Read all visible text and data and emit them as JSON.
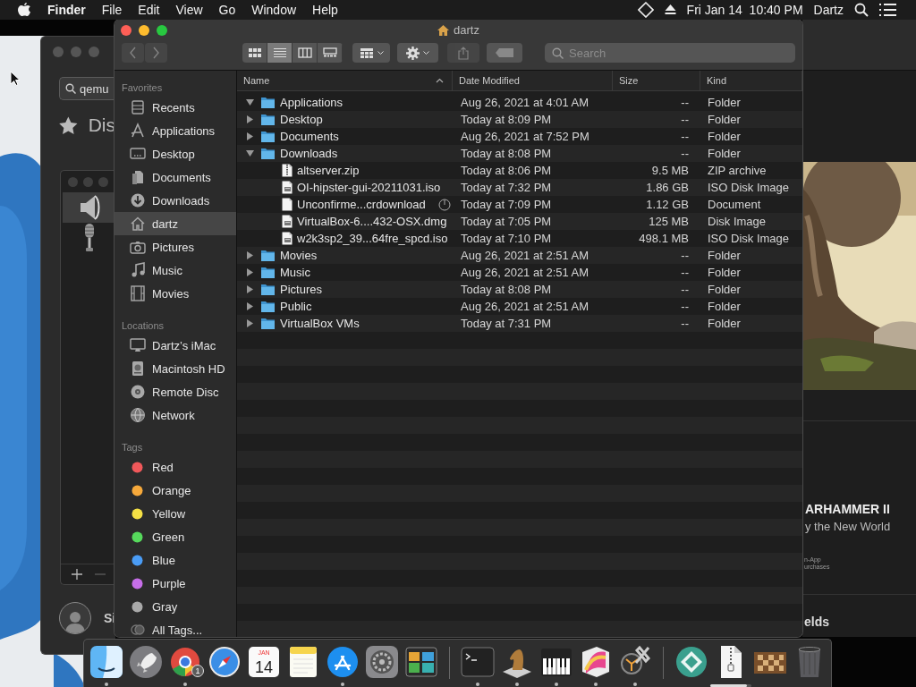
{
  "menu_bar": {
    "app": "Finder",
    "menus": [
      "File",
      "Edit",
      "View",
      "Go",
      "Window",
      "Help"
    ],
    "clock": "Fri Jan 14  10:40 PM",
    "user": "Dartz"
  },
  "preferences_window": {
    "search_value": "qemu",
    "heading": "Dis",
    "user_label": "Si",
    "devices": [
      {
        "kind": "speaker",
        "selected": true
      },
      {
        "kind": "microphone",
        "selected": false
      }
    ]
  },
  "app_store_window": {
    "title": "ARHAMMER II",
    "subtitle": "y the New World",
    "fine_print": [
      "n-App",
      "urchases"
    ],
    "section": "elds"
  },
  "finder": {
    "title": "dartz",
    "nav_buttons": [
      {
        "kind": "back",
        "disabled": true
      },
      {
        "kind": "forward",
        "disabled": true
      }
    ],
    "view_modes": [
      {
        "kind": "icons",
        "selected": false
      },
      {
        "kind": "list",
        "selected": true
      },
      {
        "kind": "columns",
        "selected": false
      },
      {
        "kind": "gallery",
        "selected": false
      }
    ],
    "share_button": {
      "disabled": true
    },
    "search": {
      "placeholder": "Search"
    },
    "sidebar": [
      {
        "heading": "Favorites",
        "items": [
          {
            "label": "Recents",
            "selected": false
          },
          {
            "label": "Applications",
            "selected": false
          },
          {
            "label": "Desktop",
            "selected": false
          },
          {
            "label": "Documents",
            "selected": false
          },
          {
            "label": "Downloads",
            "selected": false
          },
          {
            "label": "dartz",
            "selected": true
          },
          {
            "label": "Pictures",
            "selected": false
          },
          {
            "label": "Music",
            "selected": false
          },
          {
            "label": "Movies",
            "selected": false
          }
        ]
      },
      {
        "heading": "Locations",
        "items": [
          {
            "label": "Dartz’s iMac",
            "selected": false
          },
          {
            "label": "Macintosh HD",
            "selected": false
          },
          {
            "label": "Remote Disc",
            "selected": false
          },
          {
            "label": "Network",
            "selected": false
          }
        ]
      },
      {
        "heading": "Tags",
        "items": [
          {
            "label": "Red",
            "color": "#f0585a",
            "selected": false
          },
          {
            "label": "Orange",
            "color": "#f6a93b",
            "selected": false
          },
          {
            "label": "Yellow",
            "color": "#f5e045",
            "selected": false
          },
          {
            "label": "Green",
            "color": "#56d95c",
            "selected": false
          },
          {
            "label": "Blue",
            "color": "#4a9cf5",
            "selected": false
          },
          {
            "label": "Purple",
            "color": "#c66ee8",
            "selected": false
          },
          {
            "label": "Gray",
            "color": "#a9a9a9",
            "selected": false
          },
          {
            "label": "All Tags...",
            "selected": false
          }
        ]
      }
    ],
    "columns": [
      {
        "label": "Name",
        "sorted": true
      },
      {
        "label": "Date Modified",
        "sorted": false
      },
      {
        "label": "Size",
        "sorted": false
      },
      {
        "label": "Kind",
        "sorted": false
      }
    ],
    "rows": [
      {
        "name": "Applications",
        "date": "Aug 26, 2021 at 4:01 AM",
        "size": "--",
        "file_kind": "Folder",
        "kind": "folder",
        "expanded": true
      },
      {
        "name": "Desktop",
        "date": "Today at 8:09 PM",
        "size": "--",
        "file_kind": "Folder",
        "kind": "folder",
        "expanded": false
      },
      {
        "name": "Documents",
        "date": "Aug 26, 2021 at 7:52 PM",
        "size": "--",
        "file_kind": "Folder",
        "kind": "folder",
        "expanded": false
      },
      {
        "name": "Downloads",
        "date": "Today at 8:08 PM",
        "size": "--",
        "file_kind": "Folder",
        "kind": "folder",
        "expanded": true,
        "children": [
          {
            "name": "altserver.zip",
            "date": "Today at 8:06 PM",
            "size": "9.5 MB",
            "file_kind": "ZIP archive",
            "kind": "zip",
            "downloading": false
          },
          {
            "name": "OI-hipster-gui-20211031.iso",
            "date": "Today at 7:32 PM",
            "size": "1.86 GB",
            "file_kind": "ISO Disk Image",
            "kind": "disk_image",
            "downloading": false
          },
          {
            "name": "Unconfirme...crdownload",
            "date": "Today at 7:09 PM",
            "size": "1.12 GB",
            "file_kind": "Document",
            "kind": "document",
            "downloading": true
          },
          {
            "name": "VirtualBox-6....432-OSX.dmg",
            "date": "Today at 7:05 PM",
            "size": "125 MB",
            "file_kind": "Disk Image",
            "kind": "disk_image",
            "downloading": false
          },
          {
            "name": "w2k3sp2_39...64fre_spcd.iso",
            "date": "Today at 7:10 PM",
            "size": "498.1 MB",
            "file_kind": "ISO Disk Image",
            "kind": "disk_image",
            "downloading": false
          }
        ]
      },
      {
        "name": "Movies",
        "date": "Aug 26, 2021 at 2:51 AM",
        "size": "--",
        "file_kind": "Folder",
        "kind": "folder",
        "expanded": false
      },
      {
        "name": "Music",
        "date": "Aug 26, 2021 at 2:51 AM",
        "size": "--",
        "file_kind": "Folder",
        "kind": "folder",
        "expanded": false
      },
      {
        "name": "Pictures",
        "date": "Today at 8:08 PM",
        "size": "--",
        "file_kind": "Folder",
        "kind": "folder",
        "expanded": false
      },
      {
        "name": "Public",
        "date": "Aug 26, 2021 at 2:51 AM",
        "size": "--",
        "file_kind": "Folder",
        "kind": "folder",
        "expanded": false
      },
      {
        "name": "VirtualBox VMs",
        "date": "Today at 7:31 PM",
        "size": "--",
        "file_kind": "Folder",
        "kind": "folder",
        "expanded": false
      }
    ]
  },
  "dock": {
    "items": [
      {
        "kind": "finder",
        "running": true
      },
      {
        "kind": "launchpad",
        "running": false
      },
      {
        "kind": "browser",
        "running": true,
        "badge": "1"
      },
      {
        "kind": "compass",
        "running": false
      },
      {
        "kind": "calendar",
        "running": false,
        "month": "JAN",
        "day": "14"
      },
      {
        "kind": "notes",
        "running": false
      },
      {
        "kind": "store",
        "running": true
      },
      {
        "kind": "settings",
        "running": false
      },
      {
        "kind": "monitor",
        "running": false
      },
      {
        "kind": "separator"
      },
      {
        "kind": "terminal",
        "running": true
      },
      {
        "kind": "chess",
        "running": true
      },
      {
        "kind": "piano",
        "running": true
      },
      {
        "kind": "grapher",
        "running": true
      },
      {
        "kind": "utility",
        "running": true
      },
      {
        "kind": "separator"
      },
      {
        "kind": "diamond",
        "running": false
      },
      {
        "kind": "zip",
        "running": false,
        "level": 0.9
      },
      {
        "kind": "board",
        "running": false
      },
      {
        "kind": "trash",
        "running": false
      }
    ]
  }
}
